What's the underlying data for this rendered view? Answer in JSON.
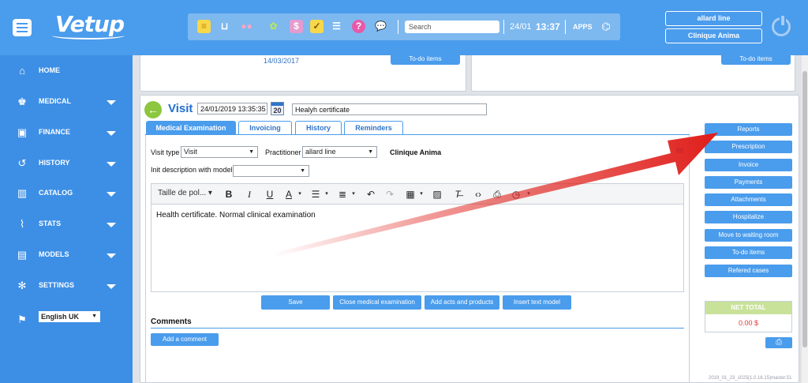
{
  "header": {
    "logo": "Vetup",
    "search_placeholder": "Search",
    "date": "24/01",
    "time": "13:37",
    "apps_label": "APPS",
    "user": "allard line",
    "clinic": "Clinique Anima",
    "toolbar_icons": [
      "document-icon",
      "basket-icon",
      "users-icon",
      "paw-icon",
      "dollar-icon",
      "calendar-check-icon",
      "checklist-icon",
      "help-icon",
      "chat-icon"
    ]
  },
  "sidebar": {
    "items": [
      {
        "label": "HOME",
        "icon": "home-icon",
        "caret": false
      },
      {
        "label": "MEDICAL",
        "icon": "medical-icon",
        "caret": true
      },
      {
        "label": "FINANCE",
        "icon": "finance-icon",
        "caret": true
      },
      {
        "label": "HISTORY",
        "icon": "history-icon",
        "caret": true
      },
      {
        "label": "CATALOG",
        "icon": "catalog-icon",
        "caret": true
      },
      {
        "label": "STATS",
        "icon": "stats-icon",
        "caret": true
      },
      {
        "label": "MODELS",
        "icon": "models-icon",
        "caret": true
      },
      {
        "label": "SETTINGS",
        "icon": "settings-icon",
        "caret": true
      }
    ],
    "language": "English UK"
  },
  "previous": {
    "date": "14/03/2017",
    "todo_label_1": "To-do items",
    "todo_label_2": "To-do items"
  },
  "visit": {
    "title": "Visit",
    "datetime": "24/01/2019 13:35:35",
    "calendar_day": "20",
    "subject": "Healyh certificate",
    "tabs": [
      "Medical Examination",
      "Invoicing",
      "History",
      "Reminders"
    ],
    "visit_type_label": "Visit type",
    "visit_type_value": "Visit",
    "practitioner_label": "Practitioner",
    "practitioner_value": "allard line",
    "clinic_name": "Clinique Anima",
    "init_label": "Init description with model",
    "init_value": "",
    "editor_font": "Taille de pol...",
    "editor_text": "Health certificate. Normal clinical examination",
    "actions": [
      "Save",
      "Close medical examination",
      "Add acts and products",
      "Insert text model"
    ],
    "comments_title": "Comments",
    "add_comment": "Add a comment"
  },
  "right_panel": {
    "buttons": [
      "Reports",
      "Prescription",
      "Invoice",
      "Payments",
      "Attachments",
      "Hospitalize",
      "Move to waiting room",
      "To-do items",
      "Refered cases"
    ],
    "net_total_label": "NET TOTAL",
    "net_total_value": "0.00 $",
    "version": "2019_01_23_1025(1.0.16.15)master.51"
  },
  "colors": {
    "accent": "#4a9cec",
    "sidebar": "#3d8fe6",
    "arrow": "#e0201c",
    "net_total_header": "#c9e29a"
  }
}
